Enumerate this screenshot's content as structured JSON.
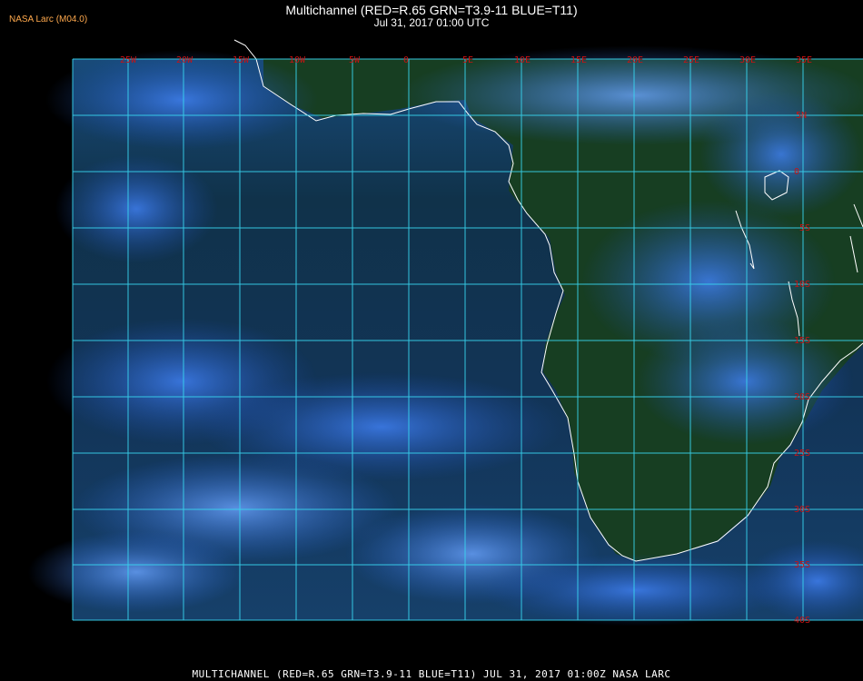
{
  "header": {
    "source_label": "NASA Larc (M04.0)",
    "title_line1": "Multichannel (RED=R.65 GRN=T3.9-11 BLUE=T11)",
    "title_line2": "Jul 31, 2017 01:00 UTC"
  },
  "footer": {
    "caption": "MULTICHANNEL (RED=R.65 GRN=T3.9-11 BLUE=T11) JUL 31, 2017 01:00Z   NASA LARC"
  },
  "map": {
    "lon_labels": [
      "25W",
      "20W",
      "15W",
      "10W",
      "5W",
      "0",
      "5E",
      "10E",
      "15E",
      "20E",
      "25E",
      "30E",
      "35E"
    ],
    "lat_labels": [
      "5N",
      "0",
      "5S",
      "10S",
      "15S",
      "20S",
      "25S",
      "30S",
      "35S",
      "40S"
    ],
    "grid_color": "#38d6f0",
    "label_color": "#cc1111",
    "coast_color": "#ffffff",
    "ocean_color": "#0b3550",
    "cloud_color": "#1f5fd6"
  }
}
